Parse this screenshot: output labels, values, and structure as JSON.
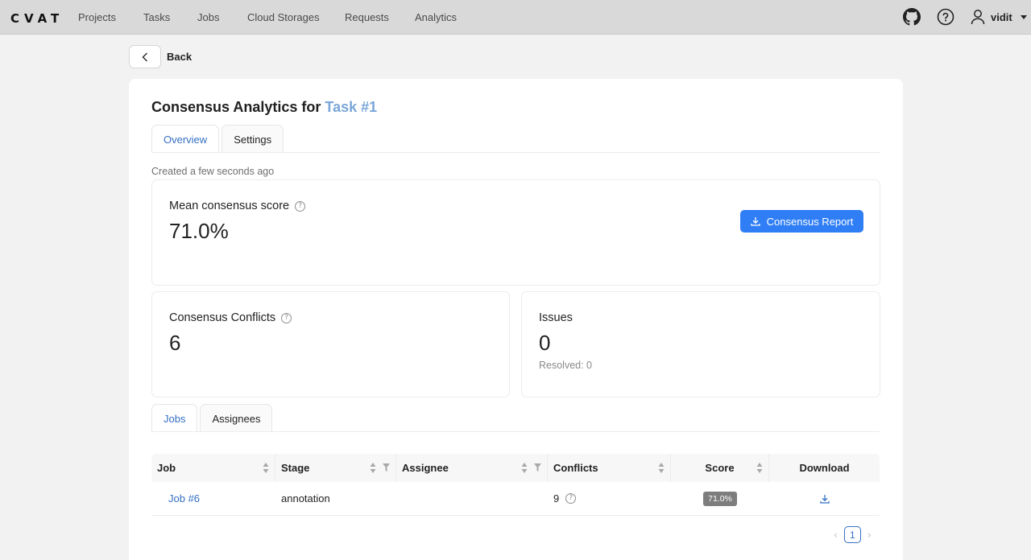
{
  "header": {
    "logo": "CVAT",
    "nav": [
      "Projects",
      "Tasks",
      "Jobs",
      "Cloud Storages",
      "Requests",
      "Analytics"
    ],
    "user": "vidit"
  },
  "back_label": "Back",
  "page": {
    "title_prefix": "Consensus Analytics for",
    "title_link": "Task #1",
    "tabs": [
      "Overview",
      "Settings"
    ],
    "created": "Created a few seconds ago"
  },
  "mean_score": {
    "label": "Mean consensus score",
    "value": "71.0%",
    "report_button": "Consensus Report"
  },
  "conflicts": {
    "label": "Consensus Conflicts",
    "value": "6"
  },
  "issues": {
    "label": "Issues",
    "value": "0",
    "resolved": "Resolved: 0"
  },
  "bottom_tabs": [
    "Jobs",
    "Assignees"
  ],
  "table": {
    "columns": [
      "Job",
      "Stage",
      "Assignee",
      "Conflicts",
      "Score",
      "Download"
    ],
    "rows": [
      {
        "job": "Job #6",
        "stage": "annotation",
        "assignee": "",
        "conflicts": "9",
        "score": "71.0%"
      }
    ]
  },
  "pagination": {
    "current": "1"
  },
  "colors": {
    "accent": "#2f7ef5",
    "link": "#3470c4",
    "title_link": "#7aa7d9",
    "header_bg": "#d9d9d9"
  },
  "icons": [
    "github-icon",
    "help-icon",
    "user-icon",
    "caret-down-icon",
    "chevron-left-icon",
    "download-icon",
    "question-icon",
    "sort-icon",
    "filter-icon"
  ]
}
